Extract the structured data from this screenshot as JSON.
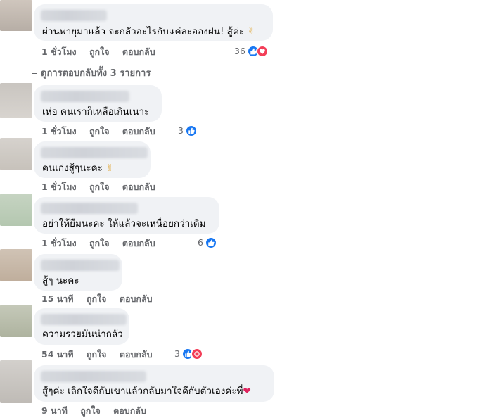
{
  "colors": {
    "bubble": "#f0f2f5",
    "meta": "#65676b",
    "like_blue": "#1877f2",
    "love_red": "#f33e58"
  },
  "comments": [
    {
      "text": "ผ่านพายุมาแล้ว จะกลัวอะไรกับแค่ละอองฝน! สู้ค่ะ",
      "emoji": "✌",
      "time": "1 ชั่วโมง",
      "like": "ถูกใจ",
      "reply": "ตอบกลับ",
      "reactions": "36",
      "reaction_icons": [
        "like-icon",
        "love-icon"
      ]
    },
    {
      "text": "เห่อ คนเราก็เหลือเกินเนาะ",
      "time": "1 ชั่วโมง",
      "like": "ถูกใจ",
      "reply": "ตอบกลับ",
      "reactions": "3",
      "reaction_icons": [
        "like-icon"
      ]
    },
    {
      "text": "คนเก่งสู้ๆนะคะ",
      "emoji": "✌",
      "time": "1 ชั่วโมง",
      "like": "ถูกใจ",
      "reply": "ตอบกลับ"
    },
    {
      "text": "อย่าให้ยืมนะคะ ให้แล้วจะเหนื่อยกว่าเดิม",
      "time": "1 ชั่วโมง",
      "like": "ถูกใจ",
      "reply": "ตอบกลับ",
      "reactions": "6",
      "reaction_icons": [
        "like-icon"
      ]
    },
    {
      "text": "สู้ๆ นะคะ",
      "time": "15 นาที",
      "like": "ถูกใจ",
      "reply": "ตอบกลับ"
    },
    {
      "text": "ความรวยมันน่ากลัว",
      "time": "54 นาที",
      "like": "ถูกใจ",
      "reply": "ตอบกลับ",
      "reactions": "3",
      "reaction_icons": [
        "like-icon",
        "haha-icon"
      ]
    },
    {
      "text": "สู้ๆค่ะ เลิกใจดีกับเขาแล้วกลับมาใจดีกับตัวเองค่ะพี่",
      "emoji": "❤",
      "time": "9 นาที",
      "like": "ถูกใจ",
      "reply": "ตอบกลับ"
    }
  ],
  "view_replies": "ดูการตอบกลับทั้ง 3 รายการ"
}
